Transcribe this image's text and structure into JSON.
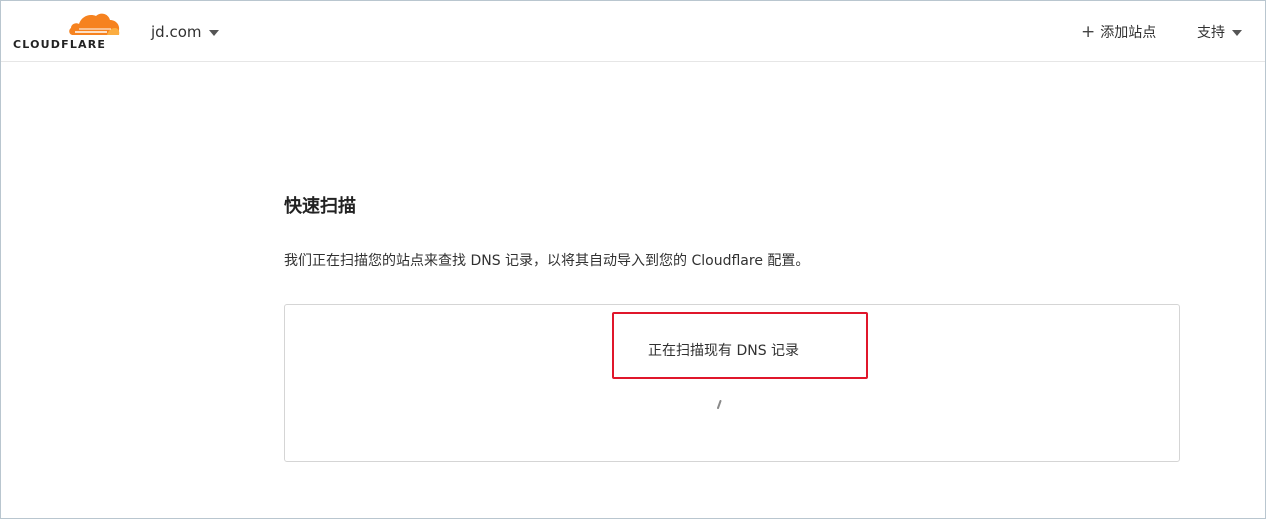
{
  "header": {
    "logo_text": "CLOUDFLARE",
    "domain": "jd.com",
    "add_site_icon": "+",
    "add_site_label": "添加站点",
    "support_label": "支持"
  },
  "main": {
    "title": "快速扫描",
    "description": "我们正在扫描您的站点来查找 DNS 记录，以将其自动导入到您的 Cloudflare 配置。",
    "scan_status": "正在扫描现有 DNS 记录"
  },
  "colors": {
    "brand_orange": "#f6821f",
    "brand_light_orange": "#fbad41",
    "highlight_red": "#e0162b"
  },
  "icons": {
    "logo": "cloudflare-cloud-icon",
    "domain_dropdown": "chevron-down-icon",
    "add_site": "plus-icon",
    "support_dropdown": "chevron-down-icon",
    "loading": "spinner-icon"
  }
}
